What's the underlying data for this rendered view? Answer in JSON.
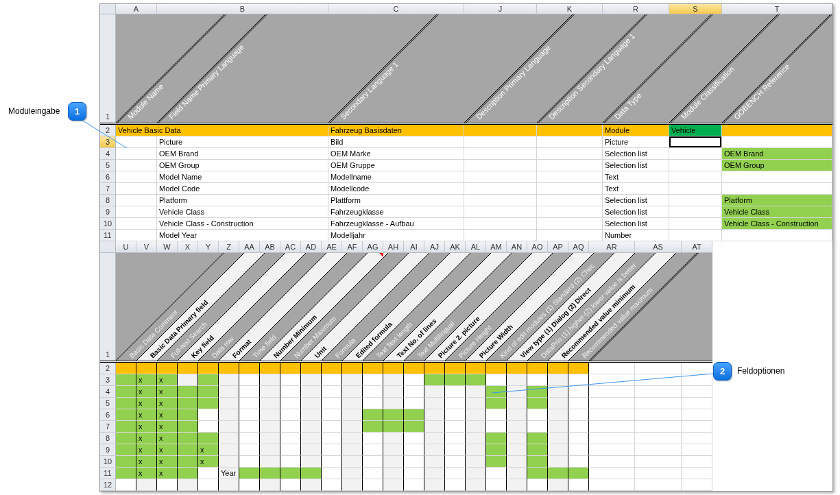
{
  "callouts": [
    {
      "number": "1",
      "label": "Moduleingabe"
    },
    {
      "number": "2",
      "label": "Feldoptionen"
    }
  ],
  "top_sheet": {
    "header_row_number": "1",
    "columns": [
      {
        "letter": "A",
        "selected": false,
        "header": "Module Name"
      },
      {
        "letter": "B",
        "selected": false,
        "header": "Field Name Primary Language"
      },
      {
        "letter": "C",
        "selected": false,
        "header": "Secondary Language 1"
      },
      {
        "letter": "J",
        "selected": false,
        "header": "Description Primary Language"
      },
      {
        "letter": "K",
        "selected": false,
        "header": "Description Secondary Language 1"
      },
      {
        "letter": "R",
        "selected": false,
        "header": "Data Type"
      },
      {
        "letter": "S",
        "selected": true,
        "header": "Module Classification"
      },
      {
        "letter": "T",
        "selected": false,
        "header": "GOBENCH Reference"
      }
    ],
    "rows": [
      {
        "number": "2",
        "selected": false,
        "kind": "section",
        "cells": [
          {
            "text": "Vehicle Basic Data"
          },
          {},
          {
            "text": "Fahrzeug Basisdaten"
          },
          {},
          {},
          {
            "text": "Module"
          },
          {
            "text": "Vehicle",
            "color": "#00b050"
          },
          {}
        ]
      },
      {
        "number": "3",
        "selected": true,
        "kind": "field",
        "cells": [
          {},
          {
            "text": "Picture"
          },
          {
            "text": "Bild"
          },
          {},
          {},
          {
            "text": "Picture"
          },
          {},
          {}
        ]
      },
      {
        "number": "4",
        "selected": false,
        "kind": "field",
        "cells": [
          {},
          {
            "text": "OEM Brand"
          },
          {
            "text": "OEM Marke"
          },
          {},
          {},
          {
            "text": "Selection list"
          },
          {},
          {
            "text": "OEM Brand",
            "color": "#92d050"
          }
        ]
      },
      {
        "number": "5",
        "selected": false,
        "kind": "field",
        "cells": [
          {},
          {
            "text": "OEM Group"
          },
          {
            "text": "OEM Gruppe"
          },
          {},
          {},
          {
            "text": "Selection list"
          },
          {},
          {
            "text": "OEM Group",
            "color": "#92d050"
          }
        ]
      },
      {
        "number": "6",
        "selected": false,
        "kind": "field",
        "cells": [
          {},
          {
            "text": "Model Name"
          },
          {
            "text": "Modellname"
          },
          {},
          {},
          {
            "text": "Text"
          },
          {},
          {}
        ]
      },
      {
        "number": "7",
        "selected": false,
        "kind": "field",
        "cells": [
          {},
          {
            "text": "Model Code"
          },
          {
            "text": "Modellcode"
          },
          {},
          {},
          {
            "text": "Text"
          },
          {},
          {}
        ]
      },
      {
        "number": "8",
        "selected": false,
        "kind": "field",
        "cells": [
          {},
          {
            "text": "Platform"
          },
          {
            "text": "Plattform"
          },
          {},
          {},
          {
            "text": "Selection list"
          },
          {},
          {
            "text": "Platform",
            "color": "#92d050"
          }
        ]
      },
      {
        "number": "9",
        "selected": false,
        "kind": "field",
        "cells": [
          {},
          {
            "text": "Vehicle Class"
          },
          {
            "text": "Fahrzeugklasse"
          },
          {},
          {},
          {
            "text": "Selection list"
          },
          {},
          {
            "text": "Vehicle Class",
            "color": "#92d050"
          }
        ]
      },
      {
        "number": "10",
        "selected": false,
        "kind": "field",
        "cells": [
          {},
          {
            "text": "Vehicle Class - Construction"
          },
          {
            "text": "Fahrzeugklasse - Aufbau"
          },
          {},
          {},
          {
            "text": "Selection list"
          },
          {},
          {
            "text": "Vehicle Class - Construction",
            "color": "#92d050"
          }
        ]
      },
      {
        "number": "11",
        "selected": false,
        "kind": "field",
        "cells": [
          {},
          {
            "text": "Model Year"
          },
          {
            "text": "Modelljahr"
          },
          {},
          {},
          {
            "text": "Number"
          },
          {},
          {}
        ]
      }
    ]
  },
  "bottom_sheet": {
    "header_row_number": "1",
    "columns": [
      {
        "letter": "U",
        "selected": false,
        "header": "Basic Data Comment",
        "muted": true
      },
      {
        "letter": "V",
        "selected": false,
        "header": "Basic Data Primary field",
        "muted": false
      },
      {
        "letter": "W",
        "selected": false,
        "header": "Full-text Search",
        "muted": true
      },
      {
        "letter": "X",
        "selected": false,
        "header": "Key field",
        "muted": false
      },
      {
        "letter": "Y",
        "selected": false,
        "header": "Data row",
        "muted": true
      },
      {
        "letter": "Z",
        "selected": false,
        "header": "Format",
        "muted": false
      },
      {
        "letter": "AA",
        "selected": false,
        "header": "Time field",
        "muted": true
      },
      {
        "letter": "AB",
        "selected": false,
        "header": "Number Minimum",
        "muted": false
      },
      {
        "letter": "AC",
        "selected": false,
        "header": "Number Maximum",
        "muted": true
      },
      {
        "letter": "AD",
        "selected": false,
        "header": "Unit",
        "muted": false
      },
      {
        "letter": "AE",
        "selected": false,
        "header": "Formula",
        "muted": true
      },
      {
        "letter": "AF",
        "selected": false,
        "header": "Edited formula",
        "muted": false
      },
      {
        "letter": "AG",
        "selected": false,
        "header": "Text Text length",
        "muted": true
      },
      {
        "letter": "AH",
        "selected": false,
        "header": "Text No. of lines",
        "muted": false
      },
      {
        "letter": "AI",
        "selected": false,
        "header": "Text Multilingual",
        "muted": true
      },
      {
        "letter": "AJ",
        "selected": false,
        "header": "Picture 2. picture",
        "muted": false
      },
      {
        "letter": "AK",
        "selected": false,
        "header": "Picture Height",
        "muted": true
      },
      {
        "letter": "AL",
        "selected": false,
        "header": "Picture Width",
        "muted": false
      },
      {
        "letter": "AM",
        "selected": false,
        "header": "Kind of edit modules (1) Standard (2) Chec",
        "muted": true
      },
      {
        "letter": "AN",
        "selected": false,
        "header": "View type (1) Dialog (2) Direct",
        "muted": false
      },
      {
        "letter": "AO",
        "selected": false,
        "header": "DataPrio (1) higher-(2) lower value is better",
        "muted": true
      },
      {
        "letter": "AP",
        "selected": false,
        "header": "Recommended value minimum",
        "muted": false
      },
      {
        "letter": "AQ",
        "selected": false,
        "header": "Recommended value maximum",
        "muted": true
      },
      {
        "letter": "AR",
        "selected": false
      },
      {
        "letter": "AS",
        "selected": false
      },
      {
        "letter": "AT",
        "selected": false
      }
    ],
    "rows": [
      {
        "number": "2",
        "selected": false,
        "kind": "section"
      },
      {
        "number": "3",
        "selected": false,
        "kind": "field",
        "cells": [
          {
            "color": "#92d050"
          },
          {
            "text": "x",
            "color": "#92d050"
          },
          {
            "text": "x",
            "color": "#92d050"
          },
          {},
          {
            "color": "#92d050"
          },
          {},
          {},
          {},
          {},
          {},
          {},
          {},
          {},
          {},
          {},
          {
            "color": "#92d050"
          },
          {
            "color": "#92d050"
          },
          {
            "color": "#92d050"
          },
          {},
          {},
          {},
          {},
          {}
        ]
      },
      {
        "number": "4",
        "selected": false,
        "kind": "field",
        "cells": [
          {
            "color": "#92d050"
          },
          {
            "text": "x",
            "color": "#92d050"
          },
          {
            "text": "x",
            "color": "#92d050"
          },
          {
            "color": "#92d050"
          },
          {
            "color": "#92d050"
          },
          {},
          {},
          {},
          {},
          {},
          {},
          {},
          {},
          {},
          {},
          {},
          {},
          {},
          {
            "color": "#92d050"
          },
          {},
          {
            "color": "#92d050"
          },
          {},
          {}
        ]
      },
      {
        "number": "5",
        "selected": false,
        "kind": "field",
        "cells": [
          {
            "color": "#92d050"
          },
          {
            "text": "x",
            "color": "#92d050"
          },
          {
            "text": "x",
            "color": "#92d050"
          },
          {
            "color": "#92d050"
          },
          {
            "color": "#92d050"
          },
          {},
          {},
          {},
          {},
          {},
          {},
          {},
          {},
          {},
          {},
          {},
          {},
          {},
          {
            "color": "#92d050"
          },
          {},
          {
            "color": "#92d050"
          },
          {},
          {}
        ]
      },
      {
        "number": "6",
        "selected": false,
        "kind": "field",
        "cells": [
          {
            "color": "#92d050"
          },
          {
            "text": "x",
            "color": "#92d050"
          },
          {
            "text": "x",
            "color": "#92d050"
          },
          {
            "color": "#92d050"
          },
          {},
          {},
          {},
          {},
          {},
          {},
          {},
          {},
          {
            "color": "#92d050"
          },
          {
            "color": "#92d050"
          },
          {
            "color": "#92d050"
          },
          {},
          {},
          {},
          {},
          {},
          {},
          {},
          {}
        ]
      },
      {
        "number": "7",
        "selected": false,
        "kind": "field",
        "cells": [
          {
            "color": "#92d050"
          },
          {
            "text": "x",
            "color": "#92d050"
          },
          {
            "text": "x",
            "color": "#92d050"
          },
          {
            "color": "#92d050"
          },
          {},
          {},
          {},
          {},
          {},
          {},
          {},
          {},
          {
            "color": "#92d050"
          },
          {
            "color": "#92d050"
          },
          {
            "color": "#92d050"
          },
          {},
          {},
          {},
          {},
          {},
          {},
          {},
          {}
        ]
      },
      {
        "number": "8",
        "selected": false,
        "kind": "field",
        "cells": [
          {
            "color": "#92d050"
          },
          {
            "text": "x",
            "color": "#92d050"
          },
          {
            "text": "x",
            "color": "#92d050"
          },
          {
            "color": "#92d050"
          },
          {
            "color": "#92d050"
          },
          {},
          {},
          {},
          {},
          {},
          {},
          {},
          {},
          {},
          {},
          {},
          {},
          {},
          {
            "color": "#92d050"
          },
          {},
          {
            "color": "#92d050"
          },
          {},
          {}
        ]
      },
      {
        "number": "9",
        "selected": false,
        "kind": "field",
        "cells": [
          {
            "color": "#92d050"
          },
          {
            "text": "x",
            "color": "#92d050"
          },
          {
            "text": "x",
            "color": "#92d050"
          },
          {
            "color": "#92d050"
          },
          {
            "text": "x",
            "color": "#92d050"
          },
          {},
          {},
          {},
          {},
          {},
          {},
          {},
          {},
          {},
          {},
          {},
          {},
          {},
          {
            "color": "#92d050"
          },
          {},
          {
            "color": "#92d050"
          },
          {},
          {}
        ]
      },
      {
        "number": "10",
        "selected": false,
        "kind": "field",
        "cells": [
          {
            "color": "#92d050"
          },
          {
            "text": "x",
            "color": "#92d050"
          },
          {
            "text": "x",
            "color": "#92d050"
          },
          {
            "color": "#92d050"
          },
          {
            "text": "x",
            "color": "#92d050"
          },
          {},
          {},
          {},
          {},
          {},
          {},
          {},
          {},
          {},
          {},
          {},
          {},
          {},
          {
            "color": "#92d050"
          },
          {},
          {
            "color": "#92d050"
          },
          {},
          {}
        ]
      },
      {
        "number": "11",
        "selected": false,
        "kind": "field",
        "cells": [
          {
            "color": "#92d050"
          },
          {
            "text": "x",
            "color": "#92d050"
          },
          {
            "text": "x",
            "color": "#92d050"
          },
          {
            "color": "#92d050"
          },
          {},
          {
            "text": "Year"
          },
          {
            "color": "#92d050"
          },
          {
            "color": "#92d050"
          },
          {
            "color": "#92d050"
          },
          {
            "color": "#92d050"
          },
          {},
          {},
          {},
          {},
          {},
          {},
          {},
          {},
          {},
          {},
          {
            "color": "#92d050"
          },
          {
            "color": "#92d050"
          },
          {
            "color": "#92d050"
          }
        ]
      },
      {
        "number": "12",
        "selected": false,
        "kind": "field"
      }
    ]
  }
}
